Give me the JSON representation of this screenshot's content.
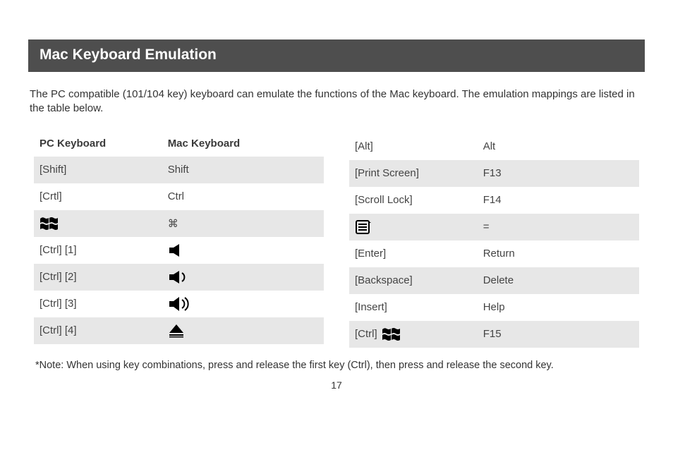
{
  "title": "Mac Keyboard Emulation",
  "intro": "The PC compatible (101/104 key) keyboard can emulate the functions of the Mac keyboard. The emulation mappings are listed in the table below.",
  "headers": {
    "pc": "PC Keyboard",
    "mac": "Mac Keyboard"
  },
  "left_rows": [
    {
      "pc_text": "[Shift]",
      "mac_text": "Shift",
      "pc_icon": "",
      "mac_icon": "",
      "stripe": true
    },
    {
      "pc_text": "[Crtl]",
      "mac_text": "Ctrl",
      "pc_icon": "",
      "mac_icon": "",
      "stripe": false
    },
    {
      "pc_text": "",
      "mac_text": "⌘",
      "pc_icon": "windows",
      "mac_icon": "",
      "stripe": true
    },
    {
      "pc_text": "[Ctrl] [1]",
      "mac_text": "",
      "pc_icon": "",
      "mac_icon": "speaker-mute",
      "stripe": false
    },
    {
      "pc_text": "[Ctrl] [2]",
      "mac_text": "",
      "pc_icon": "",
      "mac_icon": "speaker-low",
      "stripe": true
    },
    {
      "pc_text": "[Ctrl] [3]",
      "mac_text": "",
      "pc_icon": "",
      "mac_icon": "speaker-high",
      "stripe": false
    },
    {
      "pc_text": "[Ctrl] [4]",
      "mac_text": "",
      "pc_icon": "",
      "mac_icon": "eject",
      "stripe": true
    }
  ],
  "right_rows": [
    {
      "pc_text": "[Alt]",
      "mac_text": "Alt",
      "pc_icon": "",
      "mac_icon": "",
      "stripe": false
    },
    {
      "pc_text": "[Print Screen]",
      "mac_text": "F13",
      "pc_icon": "",
      "mac_icon": "",
      "stripe": true
    },
    {
      "pc_text": "[Scroll Lock]",
      "mac_text": "F14",
      "pc_icon": "",
      "mac_icon": "",
      "stripe": false
    },
    {
      "pc_text": "",
      "mac_text": "=",
      "pc_icon": "menu",
      "mac_icon": "",
      "stripe": true
    },
    {
      "pc_text": "[Enter]",
      "mac_text": "Return",
      "pc_icon": "",
      "mac_icon": "",
      "stripe": false
    },
    {
      "pc_text": "[Backspace]",
      "mac_text": "Delete",
      "pc_icon": "",
      "mac_icon": "",
      "stripe": true
    },
    {
      "pc_text": "[Insert]",
      "mac_text": "Help",
      "pc_icon": "",
      "mac_icon": "",
      "stripe": false
    },
    {
      "pc_text": "[Ctrl]",
      "mac_text": "F15",
      "pc_icon": "windows",
      "mac_icon": "",
      "stripe": true
    }
  ],
  "note": "*Note: When using key combinations, press and release the first key (Ctrl), then press and release the second key.",
  "page_number": "17"
}
